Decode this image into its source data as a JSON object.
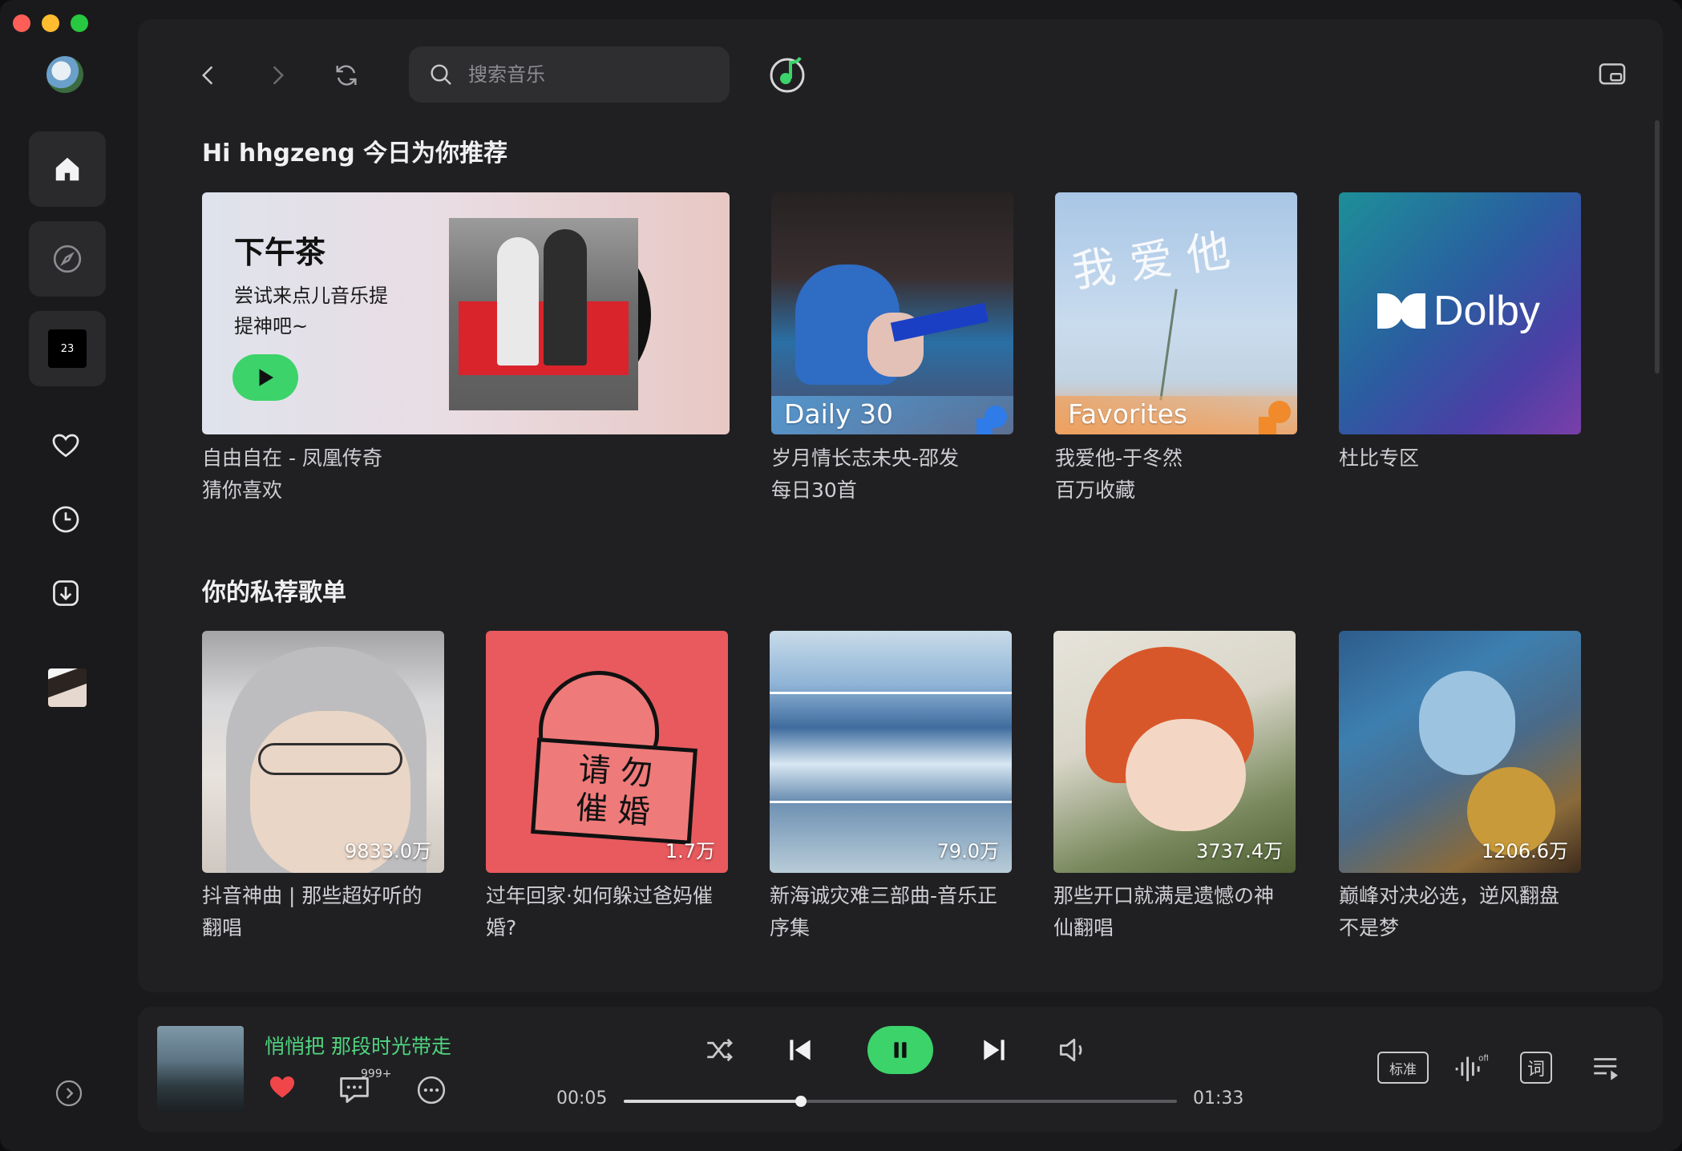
{
  "search": {
    "placeholder": "搜索音乐"
  },
  "sections": {
    "recommend_title": "Hi hhgzeng 今日为你推荐",
    "playlists_title": "你的私荐歌单"
  },
  "featured": {
    "title": "下午茶",
    "subtitle": "尝试来点儿音乐提提神吧~",
    "caption_line1": "自由自在 - 凤凰传奇",
    "caption_line2": "猜你喜欢"
  },
  "recommend_cards": [
    {
      "label": "Daily 30",
      "caption_line1": "岁月情长志未央-邵发",
      "caption_line2": "每日30首"
    },
    {
      "label": "Favorites",
      "caption_line1": "我爱他-于冬然",
      "caption_line2": "百万收藏"
    },
    {
      "label": "Dolby",
      "caption_line1": "杜比专区",
      "caption_line2": ""
    }
  ],
  "playlists": [
    {
      "count": "9833.0万",
      "caption_line1": "抖音神曲 | 那些超好听的",
      "caption_line2": "翻唱"
    },
    {
      "count": "1.7万",
      "caption_line1": "过年回家·如何躲过爸妈催",
      "caption_line2": "婚?"
    },
    {
      "count": "79.0万",
      "caption_line1": "新海诚灾难三部曲-音乐正",
      "caption_line2": "序集"
    },
    {
      "count": "3737.4万",
      "caption_line1": "那些开口就满是遗憾の神",
      "caption_line2": "仙翻唱"
    },
    {
      "count": "1206.6万",
      "caption_line1": "巅峰对决必选，逆风翻盘",
      "caption_line2": "不是梦"
    }
  ],
  "cover_text": {
    "sign_line1": "请  勿",
    "sign_line2": "催  婚",
    "handwriting": "我爱他",
    "daily_date": "23"
  },
  "player": {
    "track_title": "悄悄把 那段时光带走",
    "comment_badge": "999+",
    "elapsed": "00:05",
    "duration": "01:33",
    "progress_fraction": 0.32,
    "quality_label": "标准",
    "lyrics_label": "词"
  },
  "colors": {
    "accent": "#3cd36a",
    "heart": "#f0464a",
    "background": "#1a1a1c",
    "panel": "#202023"
  },
  "icons": [
    "back-icon",
    "forward-icon",
    "refresh-icon",
    "search-icon",
    "music-recognize-icon",
    "mini-player-icon",
    "home-icon",
    "explore-icon",
    "heart-icon",
    "history-icon",
    "download-icon",
    "expand-icon",
    "shuffle-icon",
    "previous-icon",
    "pause-icon",
    "next-icon",
    "volume-icon",
    "audio-effect-icon",
    "lyrics-icon",
    "queue-icon",
    "comment-icon",
    "more-icon"
  ]
}
